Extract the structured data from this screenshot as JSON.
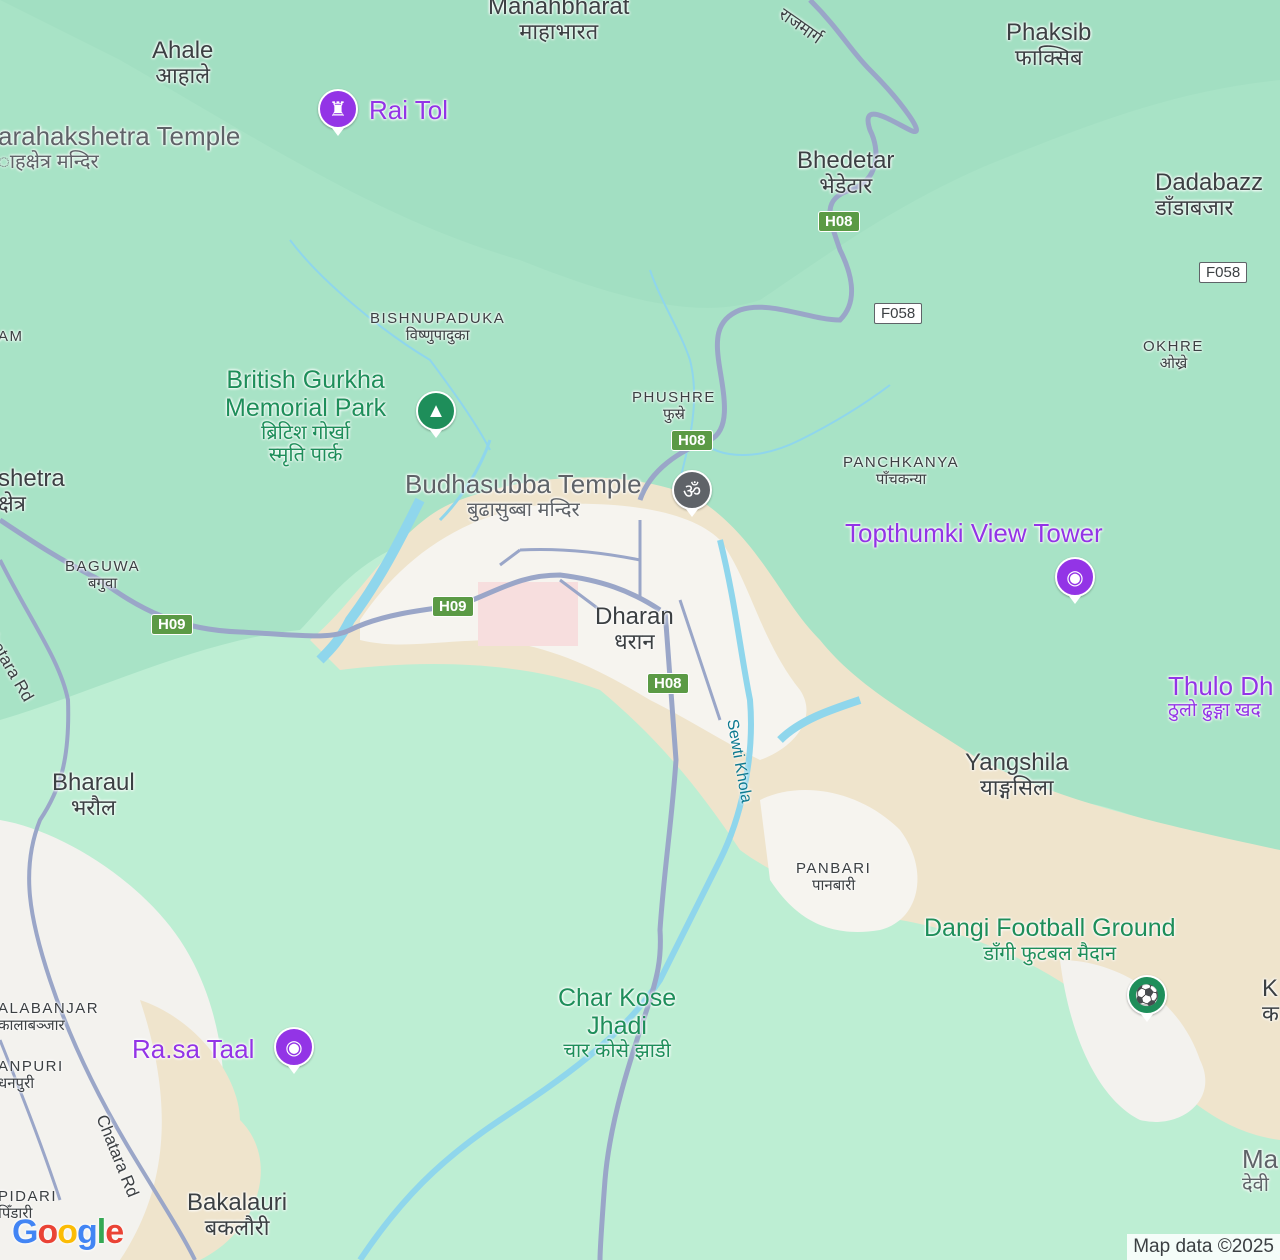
{
  "places": {
    "ahale": {
      "name": "Ahale",
      "dev": "आहाले"
    },
    "manahbharat": {
      "name": "Manahbharat",
      "dev": "माहाभारत"
    },
    "phaksib": {
      "name": "Phaksib",
      "dev": "फाक्सिब"
    },
    "bhedetar": {
      "name": "Bhedetar",
      "dev": "भेडेटार"
    },
    "dadabazar": {
      "name": "Dadabazz",
      "dev": "डाँडाबजार"
    },
    "dharan": {
      "name": "Dharan",
      "dev": "धरान"
    },
    "bharaul": {
      "name": "Bharaul",
      "dev": "भरौल"
    },
    "yangshila": {
      "name": "Yangshila",
      "dev": "याङ्गसिला"
    },
    "bakalauri": {
      "name": "Bakalauri",
      "dev": "बकलौरी"
    },
    "kshetra": {
      "name": "shetra",
      "dev": "क्षेत्र"
    }
  },
  "small_places": {
    "bishnupaduka": {
      "name": "BISHNUPADUKA",
      "dev": "विष्णुपादुका"
    },
    "phushre": {
      "name": "PHUSHRE",
      "dev": "फुस्रे"
    },
    "panchkanya": {
      "name": "PANCHKANYA",
      "dev": "पाँचकन्या"
    },
    "okhre": {
      "name": "OKHRE",
      "dev": "ओख्रे"
    },
    "baguwa": {
      "name": "BAGUWA",
      "dev": "बगुवा"
    },
    "panbari": {
      "name": "PANBARI",
      "dev": "पानबारी"
    },
    "am": {
      "name": "AM"
    },
    "kalabanjar": {
      "name": "ALABANJAR",
      "dev": "कालाबञ्जार"
    },
    "dhanpuri": {
      "name": "ANPURI",
      "dev": "धनपुरी"
    },
    "pidari": {
      "name": "PIDARI",
      "dev": "पिँडारी"
    }
  },
  "pois": {
    "rai_tol": {
      "name": "Rai Tol",
      "color": "#9334e6",
      "icon": "castle-icon"
    },
    "varahakshetra": {
      "name": "arahakshetra Temple",
      "dev": "ाहक्षेत्र मन्दिर"
    },
    "gurkha_park": {
      "name1": "British Gurkha",
      "name2": "Memorial Park",
      "dev1": "ब्रिटिश गोर्खा",
      "dev2": "स्मृति पार्क",
      "color": "#1e8e5a",
      "icon": "tree-icon"
    },
    "budhasubba": {
      "name": "Budhasubba Temple",
      "dev": "बुढासुब्बा मन्दिर",
      "color": "#5f6368",
      "icon": "om-icon"
    },
    "topthumki": {
      "name": "Topthumki View Tower",
      "color": "#9334e6",
      "icon": "camera-icon"
    },
    "thulo_dhunga": {
      "name": "Thulo Dh",
      "dev": "ठुलो ढुङ्गा खद"
    },
    "dangi_football": {
      "name": "Dangi Football Ground",
      "dev": "डाँगी फुटबल मैदान",
      "color": "#1e8e5a",
      "icon": "stadium-icon"
    },
    "char_kose": {
      "name1": "Char Kose",
      "name2": "Jhadi",
      "dev": "चार कोसे झाडी"
    },
    "rasa_taal": {
      "name": "Ra.sa Taal",
      "color": "#9334e6",
      "icon": "camera-icon"
    },
    "mai": {
      "name": "Ma",
      "dev": "देवी"
    },
    "k": {
      "name": "K",
      "dev": "क"
    }
  },
  "roads": {
    "h08": "H08",
    "h09": "H09",
    "f058": "F058",
    "chatara_rd": "Chatara Rd",
    "rajmarg": "राजमार्ग"
  },
  "rivers": {
    "sewti_khola": "Sewti Khola"
  },
  "footer": {
    "logo": "Google",
    "attribution": "Map data ©2025"
  },
  "colors": {
    "forest": "#b9eccf",
    "terrain": "#a7e2c6",
    "urban": "#f5f4ef",
    "sand": "#efe3cc",
    "water": "#8fd6ec",
    "road": "#9aa6c8",
    "highway_shield": "#5b9a45"
  }
}
